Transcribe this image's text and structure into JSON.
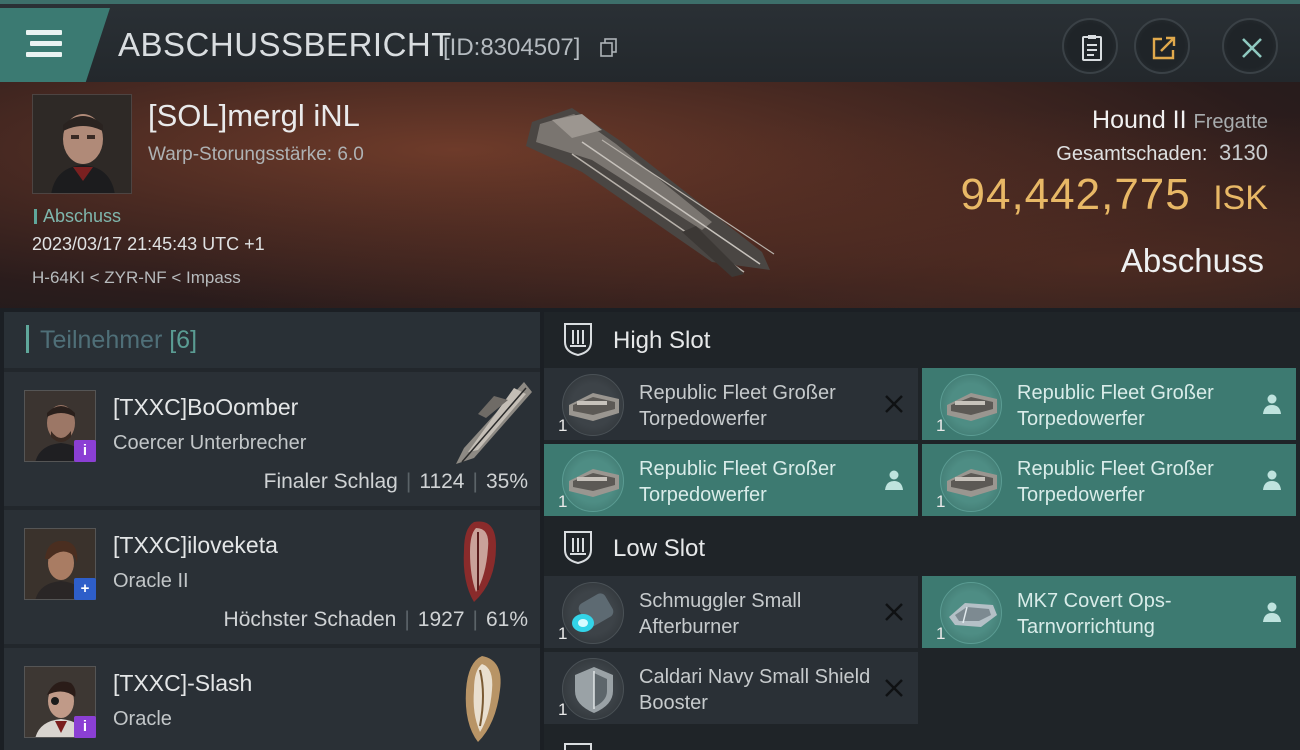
{
  "header": {
    "title": "ABSCHUSSBERICHT",
    "report_id": "[ID:8304507]"
  },
  "victim": {
    "name": "[SOL]mergl iNL",
    "warp_strength": "Warp-Storungsstärke: 6.0",
    "tag": "Abschuss",
    "timestamp": "2023/03/17 21:45:43 UTC +1",
    "location": "H-64KI < ZYR-NF < Impass",
    "ship": "Hound II",
    "ship_class": "Fregatte",
    "damage_label": "Gesamtschaden:",
    "damage_value": "3130",
    "isk_value": "94,442,775",
    "isk_unit": "ISK",
    "result": "Abschuss"
  },
  "participants": {
    "title": "Teilnehmer",
    "count": "[6]",
    "rows": [
      {
        "name": "[TXXC]BoOomber",
        "ship": "Coercer Unterbrecher",
        "role": "Finaler Schlag",
        "damage": "1124",
        "percent": "35%",
        "badge": "i"
      },
      {
        "name": "[TXXC]iloveketa",
        "ship": "Oracle II",
        "role": "Höchster Schaden",
        "damage": "1927",
        "percent": "61%",
        "badge": "+"
      },
      {
        "name": "[TXXC]-Slash",
        "ship": "Oracle",
        "role": "",
        "damage": "",
        "percent": "",
        "badge": "i"
      }
    ]
  },
  "slots": {
    "high": {
      "label": "High Slot",
      "modules": [
        {
          "name": "Republic Fleet Großer Torpedowerfer",
          "qty": "1",
          "fitted": false,
          "status": "destroyed-x-icon"
        },
        {
          "name": "Republic Fleet Großer Torpedowerfer",
          "qty": "1",
          "fitted": true,
          "status": "person-icon"
        },
        {
          "name": "Republic Fleet Großer Torpedowerfer",
          "qty": "1",
          "fitted": true,
          "status": "person-icon"
        },
        {
          "name": "Republic Fleet Großer Torpedowerfer",
          "qty": "1",
          "fitted": true,
          "status": "person-icon"
        }
      ]
    },
    "low": {
      "label": "Low Slot",
      "modules": [
        {
          "name": "Schmuggler Small Afterburner",
          "qty": "1",
          "fitted": false,
          "status": "destroyed-x-icon"
        },
        {
          "name": "MK7 Covert Ops-Tarnvorrichtung",
          "qty": "1",
          "fitted": true,
          "status": "person-icon"
        },
        {
          "name": "Caldari Navy Small Shield Booster",
          "qty": "1",
          "fitted": false,
          "status": "destroyed-x-icon"
        }
      ]
    }
  },
  "colors": {
    "accent": "#3d7a71",
    "isk": "#e8b866",
    "badge_purple": "#8b3fd4",
    "badge_blue": "#2e5ec9"
  }
}
